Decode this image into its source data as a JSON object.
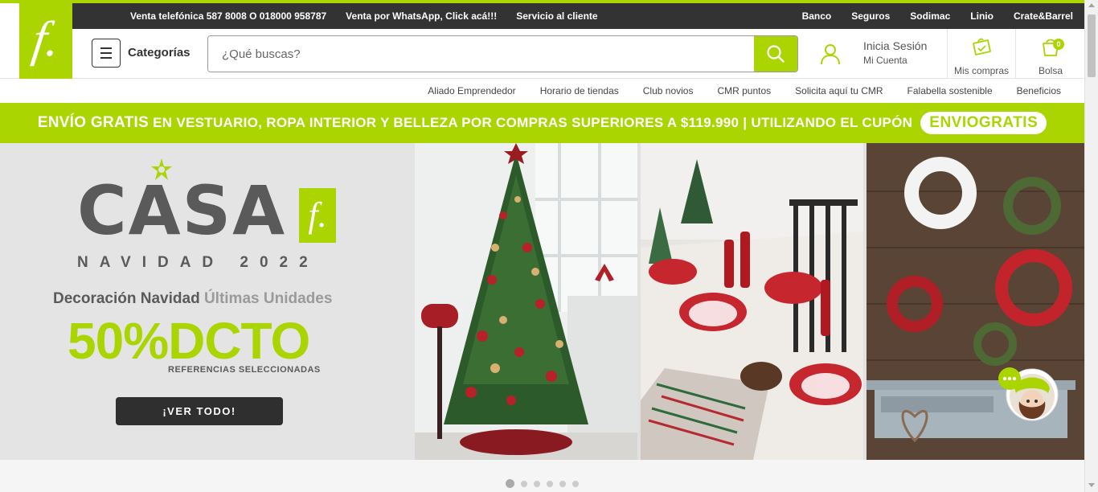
{
  "topbar": {
    "left_links": [
      "Venta telefónica 587 8008 O 018000 958787",
      "Venta por WhatsApp, Click acá!!!",
      "Servicio al cliente"
    ],
    "right_links": [
      "Banco",
      "Seguros",
      "Sodimac",
      "Linio",
      "Crate&Barrel"
    ]
  },
  "logo": {
    "mark": "f."
  },
  "header": {
    "categories_label": "Categorías",
    "search_placeholder": "¿Qué buscas?",
    "login_line1": "Inicia Sesión",
    "login_line2": "Mi Cuenta",
    "mis_compras": "Mis compras",
    "bolsa": "Bolsa",
    "bag_count": "0"
  },
  "subnav": {
    "items": [
      "Aliado Emprendedor",
      "Horario de tiendas",
      "Club novios",
      "CMR puntos",
      "Solicita aquí tu CMR",
      "Falabella sostenible",
      "Beneficios"
    ]
  },
  "promo": {
    "bold": "ENVÍO GRATIS",
    "text": " EN VESTUARIO, ROPA INTERIOR Y BELLEZA POR COMPRAS SUPERIORES A $119.990 | UTILIZANDO EL CUPÓN",
    "coupon": "ENVIOGRATIS"
  },
  "hero": {
    "brand": "CASA",
    "brand_mark": "f.",
    "subtitle": "NAVIDAD 2022",
    "deco_main": "Decoración Navidad ",
    "deco_accent": "Últimas Unidades",
    "discount": "50%DCTO",
    "refs": "REFERENCIAS SELECCIONADAS",
    "cta": "¡VER TODO!"
  },
  "carousel": {
    "slides": 6,
    "active": 0
  },
  "colors": {
    "brand_green": "#aad500",
    "topbar": "#333333",
    "cta_dark": "#2f2f2f"
  },
  "icons": [
    "menu-icon",
    "search-icon",
    "user-icon",
    "shopping-bag-icon",
    "cart-bag-icon",
    "chat-icon",
    "star-icon"
  ]
}
